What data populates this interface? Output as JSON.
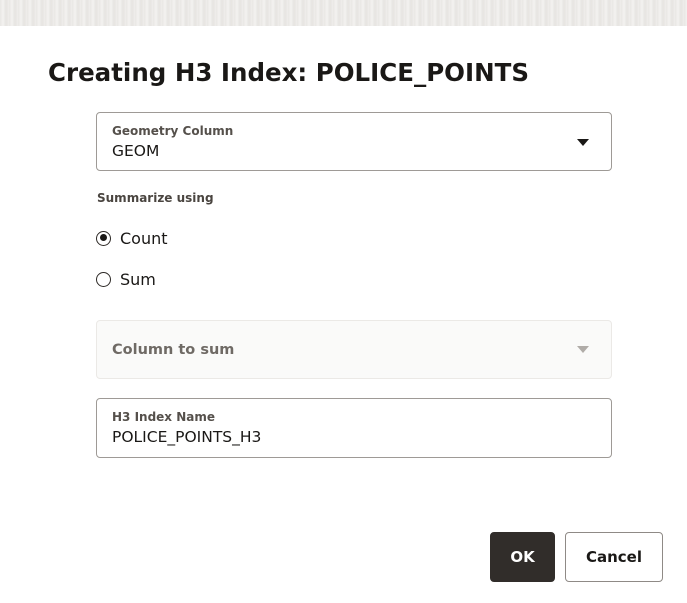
{
  "dialog": {
    "title": "Creating H3 Index: POLICE_POINTS"
  },
  "geometry_column": {
    "label": "Geometry Column",
    "value": "GEOM"
  },
  "summarize": {
    "label": "Summarize using",
    "options": [
      {
        "label": "Count",
        "selected": true
      },
      {
        "label": "Sum",
        "selected": false
      }
    ]
  },
  "column_to_sum": {
    "placeholder": "Column to sum",
    "disabled": true
  },
  "h3_index_name": {
    "label": "H3 Index Name",
    "value": "POLICE_POINTS_H3"
  },
  "buttons": {
    "ok": "OK",
    "cancel": "Cancel"
  },
  "colors": {
    "primary_button_bg": "#312d2a",
    "text": "#1a1816",
    "field_border": "#9e9a96"
  }
}
